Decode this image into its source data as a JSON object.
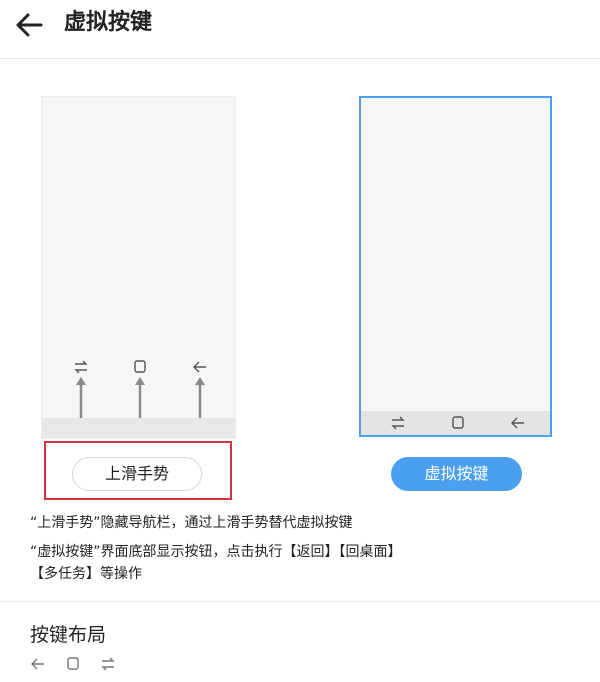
{
  "header": {
    "title": "虚拟按键",
    "back_icon": "arrow-left-icon"
  },
  "preview_gesture": {
    "icons": [
      "switch-icon",
      "square-icon",
      "back-icon"
    ],
    "button_label": "上滑手势",
    "selected": true
  },
  "preview_virtual": {
    "icons": [
      "switch-icon",
      "square-icon",
      "back-icon"
    ],
    "button_label": "虚拟按键",
    "accent": "#4aa0ef"
  },
  "description": {
    "line1": "“上滑手势”隐藏导航栏，通过上滑手势替代虚拟按键",
    "line2a": "“虚拟按键”界面底部显示按钮，点击执行【返回】【回桌面】",
    "line2b": "【多任务】等操作"
  },
  "layout_section": {
    "title": "按键布局",
    "icons": [
      "back-icon",
      "square-icon",
      "switch-icon"
    ]
  },
  "colors": {
    "accent": "#4aa0ef",
    "selection": "#d9333c"
  }
}
